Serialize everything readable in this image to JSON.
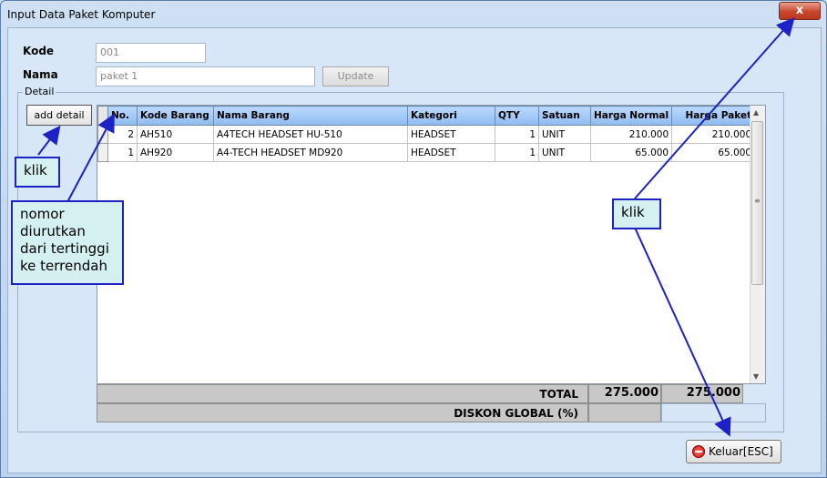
{
  "window": {
    "title": "Input Data Paket Komputer",
    "close_glyph": "x"
  },
  "form": {
    "kode_label": "Kode",
    "kode_value": "001",
    "nama_label": "Nama",
    "nama_value": "paket 1",
    "update_label": "Update"
  },
  "detail": {
    "group_label": "Detail",
    "add_label": "add detail",
    "columns": [
      "No.",
      "Kode Barang",
      "Nama Barang",
      "Kategori",
      "QTY",
      "Satuan",
      "Harga Normal",
      "Harga Paket"
    ],
    "rows": [
      {
        "no": "2",
        "kode": "AH510",
        "nama": "A4TECH HEADSET HU-510",
        "kategori": "HEADSET",
        "qty": "1",
        "satuan": "UNIT",
        "normal": "210.000",
        "paket": "210.000"
      },
      {
        "no": "1",
        "kode": "AH920",
        "nama": "A4-TECH HEADSET MD920",
        "kategori": "HEADSET",
        "qty": "1",
        "satuan": "UNIT",
        "normal": "65.000",
        "paket": "65.000"
      }
    ],
    "total_label": "TOTAL",
    "total_normal": "275.000",
    "total_paket": "275.000",
    "diskon_label": "DISKON GLOBAL (%)"
  },
  "exit_label": "Keluar[ESC]",
  "annotations": {
    "klik_left": "klik",
    "note_lines": [
      "nomor",
      "diurutkan",
      "dari tertinggi",
      "ke terrendah"
    ],
    "klik_right": "klik",
    "arrow_color": "#1d22c6"
  },
  "icons": {
    "close": "close-icon",
    "stop": "stop-icon"
  }
}
